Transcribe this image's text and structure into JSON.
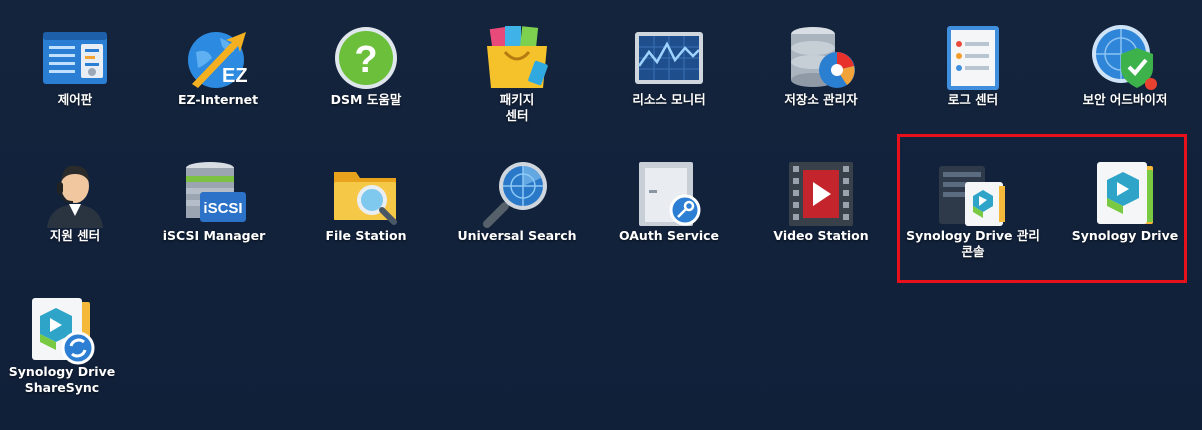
{
  "desktop": {
    "apps": [
      {
        "label": "제어판",
        "icon": "control-panel-icon"
      },
      {
        "label": "EZ-Internet",
        "icon": "ez-internet-icon"
      },
      {
        "label": "DSM 도움말",
        "icon": "help-icon"
      },
      {
        "label": "패키지\n센터",
        "icon": "package-center-icon"
      },
      {
        "label": "리소스 모니터",
        "icon": "resource-monitor-icon"
      },
      {
        "label": "저장소 관리자",
        "icon": "storage-manager-icon"
      },
      {
        "label": "로그 센터",
        "icon": "log-center-icon"
      },
      {
        "label": "보안 어드바이저",
        "icon": "security-advisor-icon"
      },
      {
        "label": "지원 센터",
        "icon": "support-center-icon"
      },
      {
        "label": "iSCSI Manager",
        "icon": "iscsi-icon"
      },
      {
        "label": "File Station",
        "icon": "file-station-icon"
      },
      {
        "label": "Universal Search",
        "icon": "universal-search-icon"
      },
      {
        "label": "OAuth Service",
        "icon": "oauth-service-icon"
      },
      {
        "label": "Video Station",
        "icon": "video-station-icon"
      },
      {
        "label": "Synology Drive 관리 콘솔",
        "icon": "drive-admin-console-icon"
      },
      {
        "label": "Synology Drive",
        "icon": "synology-drive-icon"
      },
      {
        "label": "Synology Drive ShareSync",
        "icon": "drive-sharesync-icon"
      }
    ]
  },
  "colors": {
    "background": "#13223a",
    "highlight": "#e8101a",
    "label": "#ffffff"
  }
}
